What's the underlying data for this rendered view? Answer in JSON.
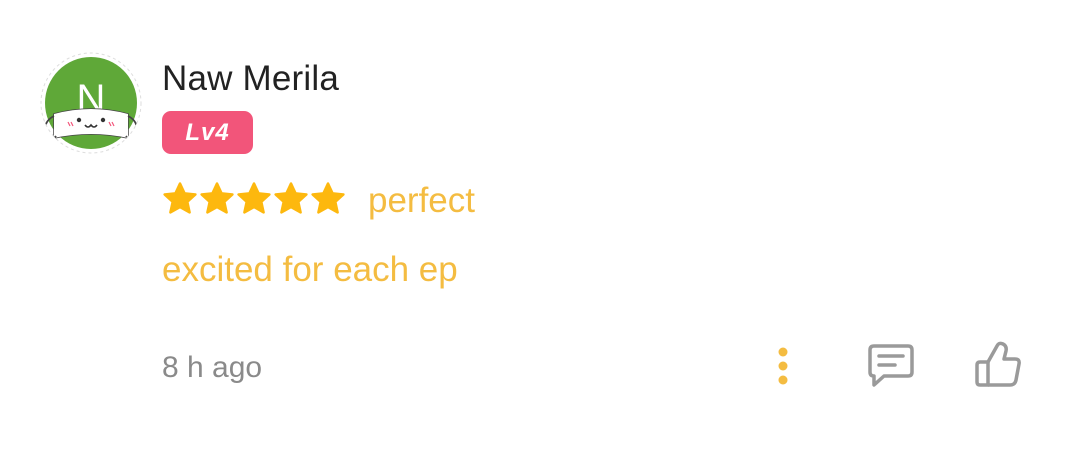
{
  "review": {
    "user_name": "Naw Merila",
    "avatar_initial": "N",
    "level_label": "Lv4",
    "star_rating": 5,
    "rating_word": "perfect",
    "text": "excited for each ep",
    "timestamp": "8 h ago"
  },
  "icons": {
    "avatar": "avatar-mask-icon",
    "star": "star-icon",
    "more": "more-vertical-icon",
    "comment": "comment-icon",
    "like": "thumbs-up-icon"
  },
  "colors": {
    "accent": "#f4bc41",
    "star": "#fdb80e",
    "badge": "#f2557a",
    "avatar_green": "#5fa838",
    "icon_gray": "#9a9a9a",
    "name": "#222222",
    "time": "#8a8a8a"
  }
}
